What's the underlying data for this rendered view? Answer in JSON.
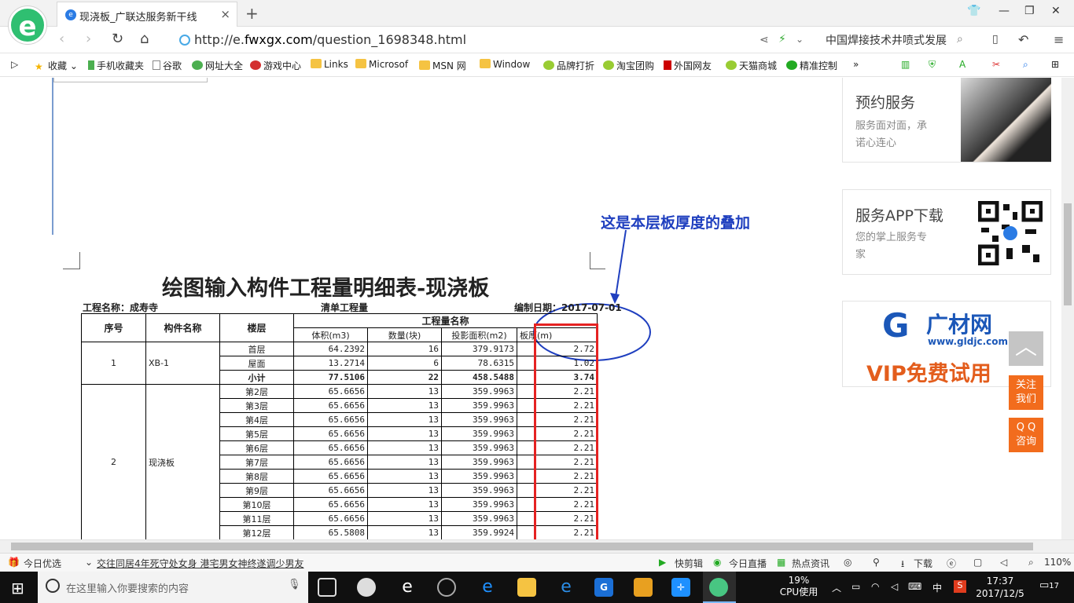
{
  "tab": {
    "title": "现浇板_广联达服务新干线",
    "close": "×",
    "new": "+"
  },
  "address": {
    "url_prefix": "http://e.",
    "url_domain": "fwxgx.com",
    "url_path": "/question_1698348.html",
    "search_text": "中国焊接技术井喷式发展"
  },
  "bookmarks": [
    "收藏",
    "手机收藏夹",
    "谷歌",
    "网址大全",
    "游戏中心",
    "Links",
    "Microsof",
    "MSN 网",
    "Window",
    "品牌打折",
    "淘宝团购",
    "外国网友",
    "天猫商城",
    "精准控制"
  ],
  "doc": {
    "annotation": "这是本层板厚度的叠加",
    "title": "绘图输入构件工程量明细表-现浇板",
    "project_label": "工程名称：成寿寺",
    "list_label": "清单工程量",
    "date_label": "编制日期：2017-07-01",
    "header": {
      "seq": "序号",
      "name": "构件名称",
      "floor": "楼层",
      "group": "工程量名称",
      "vol": "体积(m3)",
      "count": "数量(块)",
      "area": "投影面积(m2)",
      "thick": "板厚(m)"
    },
    "group1": {
      "seq": "1",
      "name": "XB-1"
    },
    "group2": {
      "seq": "2",
      "name": "现浇板"
    },
    "rows": [
      {
        "floor": "首层",
        "vol": "64.2392",
        "count": "16",
        "area": "379.9173",
        "thick": "2.72"
      },
      {
        "floor": "屋面",
        "vol": "13.2714",
        "count": "6",
        "area": "78.6315",
        "thick": "1.02"
      },
      {
        "floor": "小计",
        "vol": "77.5106",
        "count": "22",
        "area": "458.5488",
        "thick": "3.74"
      },
      {
        "floor": "第2层",
        "vol": "65.6656",
        "count": "13",
        "area": "359.9963",
        "thick": "2.21"
      },
      {
        "floor": "第3层",
        "vol": "65.6656",
        "count": "13",
        "area": "359.9963",
        "thick": "2.21"
      },
      {
        "floor": "第4层",
        "vol": "65.6656",
        "count": "13",
        "area": "359.9963",
        "thick": "2.21"
      },
      {
        "floor": "第5层",
        "vol": "65.6656",
        "count": "13",
        "area": "359.9963",
        "thick": "2.21"
      },
      {
        "floor": "第6层",
        "vol": "65.6656",
        "count": "13",
        "area": "359.9963",
        "thick": "2.21"
      },
      {
        "floor": "第7层",
        "vol": "65.6656",
        "count": "13",
        "area": "359.9963",
        "thick": "2.21"
      },
      {
        "floor": "第8层",
        "vol": "65.6656",
        "count": "13",
        "area": "359.9963",
        "thick": "2.21"
      },
      {
        "floor": "第9层",
        "vol": "65.6656",
        "count": "13",
        "area": "359.9963",
        "thick": "2.21"
      },
      {
        "floor": "第10层",
        "vol": "65.6656",
        "count": "13",
        "area": "359.9963",
        "thick": "2.21"
      },
      {
        "floor": "第11层",
        "vol": "65.6656",
        "count": "13",
        "area": "359.9963",
        "thick": "2.21"
      },
      {
        "floor": "第12层",
        "vol": "65.5808",
        "count": "13",
        "area": "359.9924",
        "thick": "2.21"
      }
    ]
  },
  "sidebar": {
    "appointment": {
      "title": "预约服务",
      "desc1": "服务面对面，承",
      "desc2": "诺心连心"
    },
    "app": {
      "title": "服务APP下载",
      "desc1": "您的掌上服务专",
      "desc2": "家"
    },
    "ad": {
      "brand": "广材网",
      "site": "www.gldjc.com",
      "slogan": "VIP免费试用"
    },
    "follow": {
      "line1": "关注",
      "line2": "我们"
    },
    "qq": {
      "line1": "Q Q",
      "line2": "咨询"
    }
  },
  "statusbar": {
    "today": "今日优选",
    "news": "交往同居4年死守处女身 港宅男女神终遂调少男友",
    "cut": "快剪辑",
    "live": "今日直播",
    "hot": "热点资讯",
    "download": "下载",
    "zoom": "110%"
  },
  "taskbar": {
    "search": "在这里输入你要搜索的内容",
    "cpu_pct": "19%",
    "cpu_label": "CPU使用",
    "ime": "中",
    "time": "17:37",
    "date": "2017/12/5",
    "notif": "17"
  }
}
